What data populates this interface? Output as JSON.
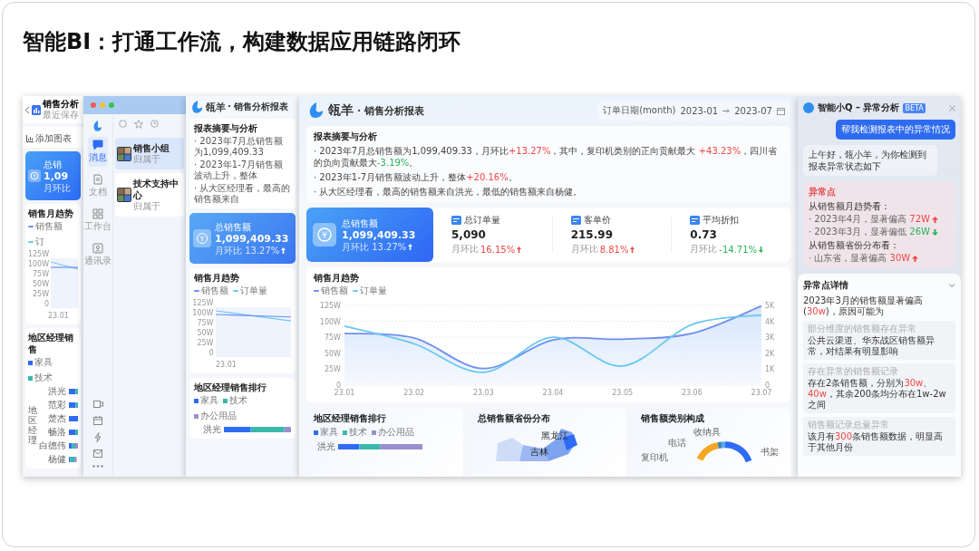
{
  "slide": {
    "title": "智能BI：打通工作流，构建数据应用链路闭环"
  },
  "back_window": {
    "title": "销售分析",
    "subtitle": "最近保存",
    "add_chart": "添加图表",
    "kpi": {
      "label": "总销",
      "value": "1,09",
      "change_label": "月环比"
    },
    "trend": {
      "title": "销售月趋势",
      "legend": [
        "销售额",
        "订"
      ],
      "yticks": [
        "125W",
        "100W",
        "75W",
        "50W",
        "25W",
        "0"
      ],
      "xticks": [
        "23.01"
      ]
    },
    "ranking": {
      "title": "地区经理销售",
      "legend": [
        {
          "label": "家具",
          "color": "#2e6cf6"
        },
        {
          "label": "技术",
          "color": "#3bb8aa"
        }
      ],
      "axis_label": "地区经理",
      "rows": [
        {
          "name": "洪光"
        },
        {
          "name": "范彩"
        },
        {
          "name": "楚杰"
        },
        {
          "name": "畅洛"
        },
        {
          "name": "白德伟"
        },
        {
          "name": "杨健"
        }
      ]
    }
  },
  "chat_window": {
    "rail": [
      {
        "kind": "message",
        "label": "消息",
        "selected": true
      },
      {
        "kind": "doc",
        "label": "文档",
        "selected": false
      },
      {
        "kind": "workbench",
        "label": "工作台",
        "selected": false
      },
      {
        "kind": "contacts",
        "label": "通讯录",
        "selected": false
      }
    ],
    "chats": [
      {
        "name": "销售小组",
        "preview": "归属于",
        "selected": true
      },
      {
        "name": "技术支持中心",
        "preview": "归属于",
        "selected": false
      }
    ]
  },
  "middle_window": {
    "brand": "瓴羊",
    "title": "· 销售分析报表",
    "summary_title": "报表摘要与分析",
    "summary": [
      "· 2023年7月总销售额为1,099,409.33",
      "· 2023年1-7月销售额波动上升，整体",
      "· 从大区经理看，最高的销售额来自"
    ],
    "kpi": {
      "label": "总销售额",
      "value": "1,099,409.33",
      "change": "月环比 13.27%",
      "rise": true
    },
    "trend": {
      "title": "销售月趋势",
      "legend": [
        "销售额",
        "订单量"
      ],
      "yticks": [
        "125W",
        "100W",
        "75W",
        "50W",
        "25W",
        "0"
      ],
      "xticks": [
        "23.01"
      ]
    },
    "ranking": {
      "title": "地区经理销售排行",
      "legend": [
        {
          "label": "家具",
          "color": "#2e6cf6"
        },
        {
          "label": "技术",
          "color": "#3bb8aa"
        },
        {
          "label": "办公用品",
          "color": "#9b8fd0"
        }
      ],
      "rows": [
        {
          "name": "洪光"
        }
      ]
    }
  },
  "front_window": {
    "brand": "瓴羊",
    "title": "· 销售分析报表",
    "date_filter": {
      "label": "订单日期(month)",
      "start": "2023-01",
      "end": "2023-07"
    },
    "summary_title": "报表摘要与分析",
    "summary": [
      [
        {
          "text": "· 2023年7月总销售额为1,099,409.33，月环比"
        },
        {
          "text": "+13.27%",
          "rise": true
        },
        {
          "text": "，其中，复印机类别的正向贡献最大 "
        },
        {
          "text": "+43.23%",
          "rise": true
        },
        {
          "text": "，四川省的负向贡献最大"
        },
        {
          "text": "-3.19%",
          "rise": false
        },
        {
          "text": "。"
        }
      ],
      [
        {
          "text": "· 2023年1-7月销售额波动上升，整体"
        },
        {
          "text": "+20.16%",
          "rise": true
        },
        {
          "text": "。"
        }
      ],
      [
        {
          "text": "· 从大区经理看，最高的销售额来自洪光，最低的销售额来自杨健。"
        }
      ]
    ],
    "kpis": [
      {
        "kind": "hero",
        "label": "总销售额",
        "value": "1,099,409.33",
        "change_label": "月环比",
        "change": "13.27%",
        "rise": true
      },
      {
        "kind": "plain",
        "label": "总订单量",
        "value": "5,090",
        "change_label": "月环比",
        "change": "16.15%",
        "rise": true
      },
      {
        "kind": "plain",
        "label": "客单价",
        "value": "215.99",
        "change_label": "月环比",
        "change": "8.81%",
        "rise": true
      },
      {
        "kind": "plain",
        "label": "平均折扣",
        "value": "0.73",
        "change_label": "月环比",
        "change": "-14.71%",
        "rise": false
      }
    ],
    "chart": {
      "title": "销售月趋势",
      "chart_data": {
        "type": "area",
        "grid": true,
        "categories": [
          "23.01",
          "23.02",
          "23.03",
          "23.04",
          "23.05",
          "23.06",
          "23.07"
        ],
        "series": [
          {
            "name": "销售额",
            "color": "#6f8ff0",
            "axis": "y",
            "type": "area",
            "values": [
              81,
              74,
              26,
              71,
              72,
              81,
              124
            ]
          },
          {
            "name": "订单量",
            "color": "#6cc8f0",
            "axis": "y2",
            "type": "line",
            "values": [
              3.7,
              2.6,
              0.8,
              3,
              1.2,
              3.8,
              4.4
            ]
          }
        ],
        "ylim": [
          0,
          125
        ],
        "yticks": [
          {
            "value": 0,
            "label": "0"
          },
          {
            "value": 25,
            "label": "25W"
          },
          {
            "value": 50,
            "label": "50W"
          },
          {
            "value": 75,
            "label": "75W"
          },
          {
            "value": 100,
            "label": "100W"
          },
          {
            "value": 125,
            "label": "125W"
          }
        ],
        "y2lim": [
          0,
          5
        ],
        "y2ticks": [
          {
            "value": 0,
            "label": "0"
          },
          {
            "value": 1,
            "label": "1K"
          },
          {
            "value": 2,
            "label": "2K"
          },
          {
            "value": 3,
            "label": "3K"
          },
          {
            "value": 4,
            "label": "4K"
          },
          {
            "value": 5,
            "label": "5K"
          }
        ]
      }
    },
    "bottom_cards": [
      {
        "kind": "ranking",
        "title": "地区经理销售排行",
        "legend": [
          {
            "label": "家具",
            "color": "#2e6cf6"
          },
          {
            "label": "技术",
            "color": "#3bb8aa"
          },
          {
            "label": "办公用品",
            "color": "#9b8fd0"
          }
        ],
        "rows": [
          {
            "name": "洪光"
          }
        ]
      },
      {
        "kind": "map",
        "title": "总销售额省份分布",
        "labels": [
          "黑龙江",
          "吉林"
        ]
      },
      {
        "kind": "donut",
        "title": "销售额类别构成",
        "labels": [
          {
            "text": "收纳具",
            "color": "#5aa9f0"
          },
          {
            "text": "电话",
            "color": "#3e86b8"
          },
          {
            "text": "复印机",
            "color": "#f5a623"
          },
          {
            "text": "书架",
            "color": "#2e6cf6"
          }
        ]
      }
    ]
  },
  "ai_panel": {
    "title": "智能小Q – 异常分析",
    "badge": "BETA",
    "user_message": "帮我检测报表中的异常情况",
    "bot_message": "上午好，瓴小羊，为你检测到报表异常状态如下",
    "anomalies": {
      "title": "异常点",
      "groups": [
        {
          "heading": "从销售额月趋势看：",
          "items": [
            {
              "text": "· 2023年4月，显著偏高",
              "value": "72W",
              "rise": true
            },
            {
              "text": "· 2023年3月，显著偏低",
              "value": "26W",
              "rise": false
            }
          ]
        },
        {
          "heading": "从销售额省份分布看：",
          "items": [
            {
              "text": "· 山东省，显著偏高",
              "value": "30W",
              "rise": true
            }
          ]
        }
      ]
    },
    "details": {
      "title": "异常点详情",
      "expanded": true,
      "intro": [
        {
          "text": "2023年3月的销售额显著偏高("
        },
        {
          "text": "30w",
          "rise": true
        },
        {
          "text": ")，原因可能为"
        }
      ],
      "reasons": [
        {
          "label": "部分维度的销售额存在异常",
          "text": [
            {
              "text": "公共云渠道、华东战区销售额异常，对结果有明显影响"
            }
          ]
        },
        {
          "label": "存在异常的销售额记录",
          "text": [
            {
              "text": "存在2条销售额，分别为"
            },
            {
              "text": "30w",
              "rise": true
            },
            {
              "text": "、"
            },
            {
              "text": "40w",
              "rise": true
            },
            {
              "text": "，其余200条均分布在1w-2w之间"
            }
          ]
        },
        {
          "label": "销售额记录总量异常",
          "text": [
            {
              "text": "该月有"
            },
            {
              "text": "300",
              "rise": true
            },
            {
              "text": "条销售额数据，明显高于其他月份"
            }
          ]
        }
      ]
    }
  }
}
